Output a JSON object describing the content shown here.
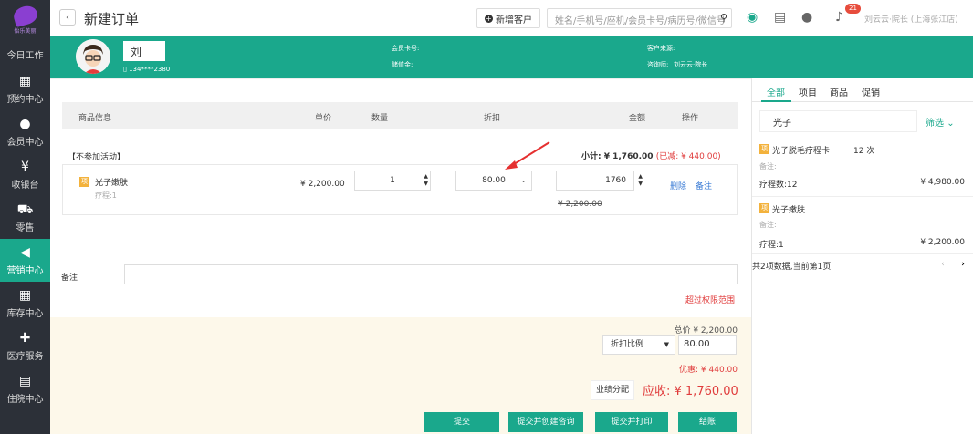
{
  "sidebar": {
    "logo_text": "怡乐美丽",
    "items": [
      {
        "label": "今日工作",
        "icon": "home-icon"
      },
      {
        "label": "预约中心",
        "icon": "calendar-icon",
        "glyph": "▦"
      },
      {
        "label": "会员中心",
        "icon": "users-icon",
        "glyph": "●"
      },
      {
        "label": "收银台",
        "icon": "yen-icon",
        "glyph": "¥"
      },
      {
        "label": "零售",
        "icon": "cart-icon",
        "glyph": "⛟"
      },
      {
        "label": "营销中心",
        "icon": "megaphone-icon",
        "glyph": "◀"
      },
      {
        "label": "库存中心",
        "icon": "grid-icon",
        "glyph": "▦"
      },
      {
        "label": "医疗服务",
        "icon": "medkit-icon",
        "glyph": "✚"
      },
      {
        "label": "住院中心",
        "icon": "clipboard-icon",
        "glyph": "▤"
      }
    ]
  },
  "header": {
    "title": "新建订单",
    "new_customer": "新增客户",
    "search_placeholder": "姓名/手机号/座机/会员卡号/病历号/微信号",
    "badge": "21",
    "user": "刘云云·院长 (上海张江店)"
  },
  "customer": {
    "name": "刘",
    "phone": "134****2380",
    "card_label": "会员卡号:",
    "balance_label": "储值金:",
    "source_label": "客户来源:",
    "consultant_label": "咨询师:",
    "consultant": "刘云云·院长"
  },
  "table": {
    "headers": [
      "商品信息",
      "单价",
      "数量",
      "折扣",
      "金额",
      "操作"
    ],
    "group_title": "【不参加活动】",
    "subtotal": "小计: ¥ 1,760.00",
    "saved": "(已减: ¥ 440.00)",
    "row": {
      "tag": "项",
      "name": "光子嫩肤",
      "sub": "疗程:1",
      "price": "¥ 2,200.00",
      "qty": "1",
      "discount": "80.00",
      "amount": "1760",
      "orig_amount": "¥ 2,200.00",
      "delete": "删除",
      "note": "备注"
    }
  },
  "note_label": "备注",
  "exceed": "超过权限范围",
  "summary": {
    "total": "总价 ¥ 2,200.00",
    "discount_mode": "折扣比例",
    "discount_value": "80.00",
    "discount_amount": "优惠: ¥ 440.00",
    "perf_button": "业绩分配",
    "receivable": "应收: ¥ 1,760.00"
  },
  "buttons": {
    "submit": "提交",
    "submit_consult": "提交并创建咨询",
    "submit_print": "提交并打印",
    "checkout": "结账"
  },
  "right": {
    "tabs": [
      "全部",
      "项目",
      "商品",
      "促销"
    ],
    "search_value": "光子",
    "filter": "筛选",
    "cards": [
      {
        "tag": "项",
        "name": "光子脱毛疗程卡",
        "count": "12 次",
        "note": "备注:",
        "left": "疗程数:12",
        "price": "¥ 4,980.00"
      },
      {
        "tag": "项",
        "name": "光子嫩肤",
        "note": "备注:",
        "left": "疗程:1",
        "price": "¥ 2,200.00"
      }
    ],
    "pager": "共2项数据,当前第1页",
    "prev": "‹",
    "next": "›"
  },
  "colors": {
    "accent": "#1aa88c",
    "sidebar": "#2c3038",
    "warn": "#e03c3c"
  }
}
